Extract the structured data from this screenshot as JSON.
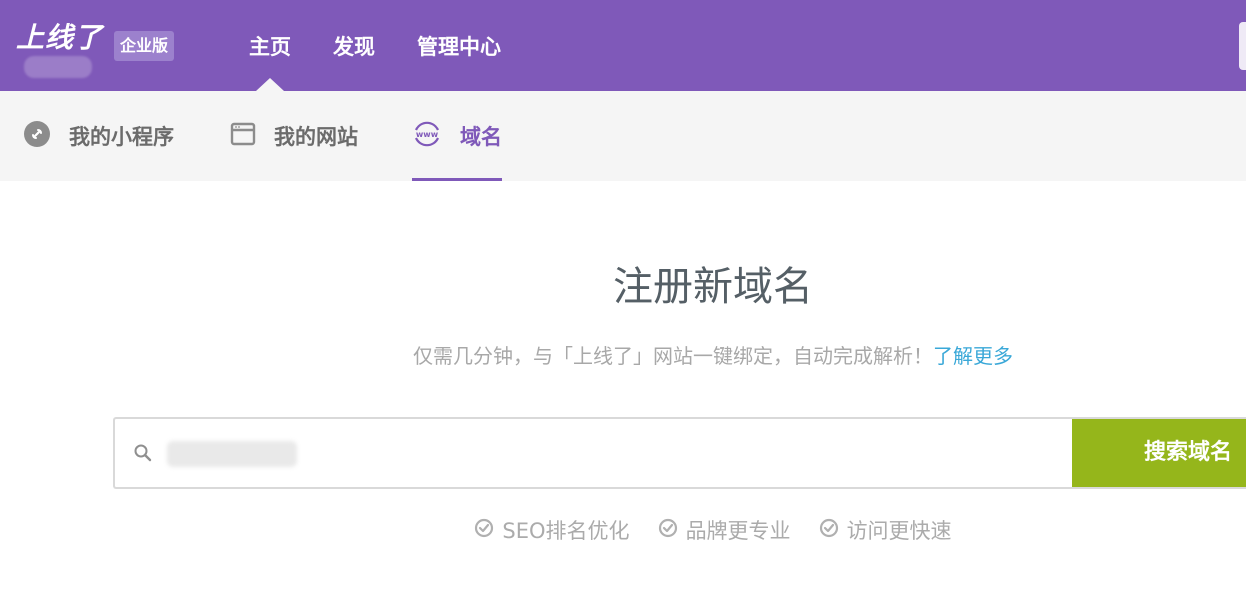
{
  "header": {
    "logo": "上线了",
    "edition_badge": "企业版",
    "nav": [
      {
        "label": "主页",
        "active": true
      },
      {
        "label": "发现",
        "active": false
      },
      {
        "label": "管理中心",
        "active": false
      }
    ]
  },
  "subnav": {
    "tabs": [
      {
        "label": "我的小程序",
        "icon": "link-icon",
        "active": false
      },
      {
        "label": "我的网站",
        "icon": "browser-window-icon",
        "active": false
      },
      {
        "label": "域名",
        "icon": "www-icon",
        "active": true
      }
    ]
  },
  "main": {
    "title": "注册新域名",
    "subtitle": "仅需几分钟，与「上线了」网站一键绑定，自动完成解析！",
    "learn_more": "了解更多",
    "search": {
      "placeholder": "",
      "button_label": "搜索域名"
    },
    "features": [
      "SEO排名优化",
      "品牌更专业",
      "访问更快速"
    ]
  },
  "colors": {
    "brand_purple": "#7f59b9",
    "search_button_green": "#95b61b",
    "link_blue": "#3aa8d8"
  }
}
